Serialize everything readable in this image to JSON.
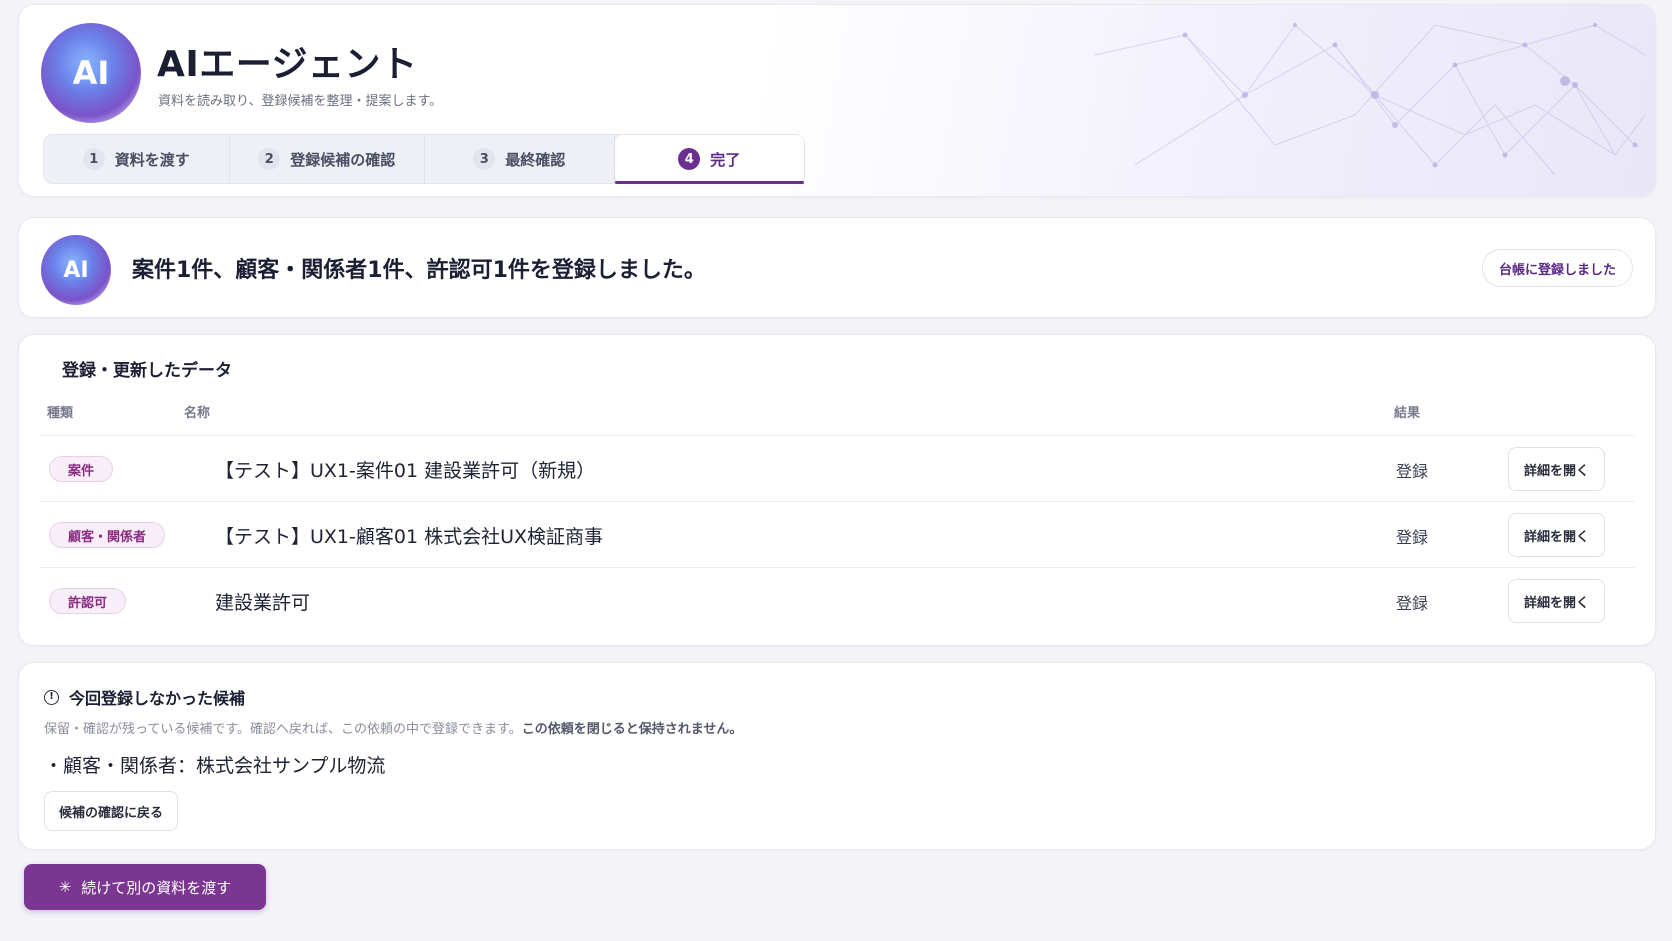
{
  "header": {
    "logo_text": "AI",
    "title": "AIエージェント",
    "subtitle": "資料を読み取り、登録候補を整理・提案します。",
    "steps": [
      {
        "num": "1",
        "label": "資料を渡す"
      },
      {
        "num": "2",
        "label": "登録候補の確認"
      },
      {
        "num": "3",
        "label": "最終確認"
      },
      {
        "num": "4",
        "label": "完了"
      }
    ],
    "active_step": 4
  },
  "banner": {
    "logo_text": "AI",
    "message": "案件1件、顧客・関係者1件、許認可1件を登録しました。",
    "status_label": "台帳に登録しました"
  },
  "data_table": {
    "title": "登録・更新したデータ",
    "columns": {
      "type": "種類",
      "name": "名称",
      "result": "結果"
    },
    "rows": [
      {
        "type": "案件",
        "name": "【テスト】UX1-案件01 建設業許可（新規）",
        "result": "登録",
        "action": "詳細を開く"
      },
      {
        "type": "顧客・関係者",
        "name": "【テスト】UX1-顧客01 株式会社UX検証商事",
        "result": "登録",
        "action": "詳細を開く"
      },
      {
        "type": "許認可",
        "name": "建設業許可",
        "result": "登録",
        "action": "詳細を開く"
      }
    ]
  },
  "pending": {
    "icon": "info-icon",
    "title": "今回登録しなかった候補",
    "description": "保留・確認が残っている候補です。確認へ戻れば、この依頼の中で登録できます。",
    "description_bold": "この依頼を閉じると保持されません。",
    "items": [
      "・顧客・関係者：株式会社サンプル物流"
    ],
    "back_button": "候補の確認に戻る"
  },
  "primary_button": {
    "icon": "sparkle-icon",
    "label": "続けて別の資料を渡す"
  },
  "colors": {
    "accent": "#6a2f8f",
    "tag_bg": "#f7eef8",
    "tag_text": "#8b2c82"
  }
}
